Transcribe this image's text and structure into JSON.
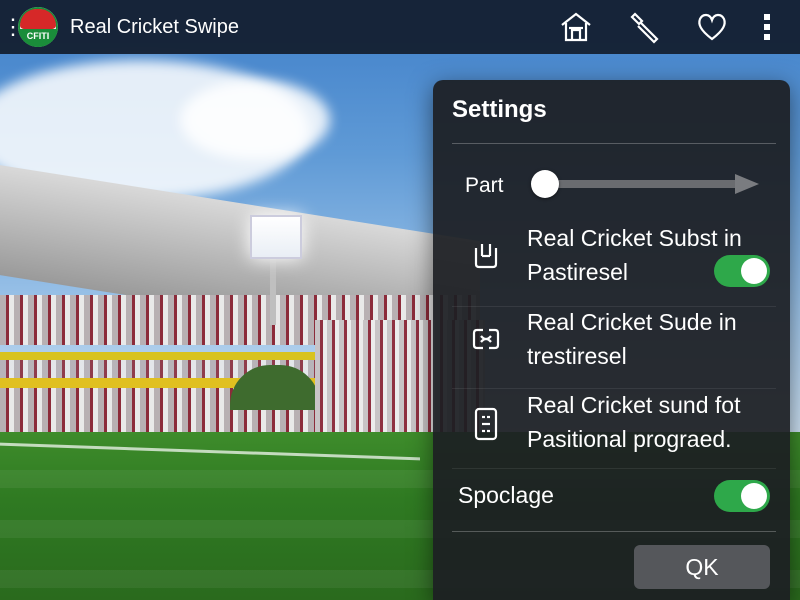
{
  "app": {
    "title": "Real Cricket Swipe",
    "logo_text": "CFITI"
  },
  "topbar": {
    "icons": [
      "menu-icon",
      "home-icon",
      "wrench-icon",
      "heart-icon",
      "more-vertical-icon"
    ]
  },
  "settings": {
    "title": "Settings",
    "slider": {
      "label": "Part",
      "value": 0
    },
    "options": [
      {
        "icon": "device-icon",
        "line1": "Real Cricket Subst in",
        "line2": "Pastiresel",
        "toggle": true
      },
      {
        "icon": "link-icon",
        "line1": "Real Cricket Sude in",
        "line2": "trestiresel"
      },
      {
        "icon": "tablet-icon",
        "line1": "Real Cricket sund fot",
        "line2": "Pasitional prograed."
      }
    ],
    "spoclage": {
      "label": "Spoclage",
      "toggle": true
    },
    "ok_label": "QK"
  },
  "colors": {
    "topbar": "#121c2c",
    "panel": "#1c1e22",
    "toggle_on": "#2ea84a",
    "pitch": "#2f7a22"
  }
}
